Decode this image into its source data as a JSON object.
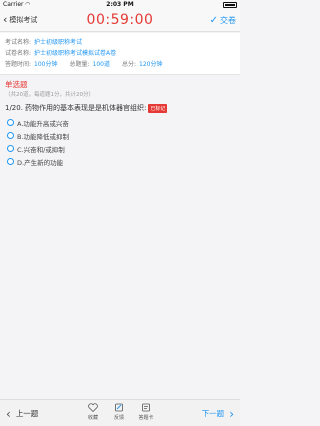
{
  "status_bar": {
    "carrier": "Carrier",
    "time": "2:03 PM"
  },
  "nav": {
    "back_label": "模拟考试",
    "timer": "00:59:00",
    "submit_label": "交卷"
  },
  "exam_info": {
    "name_label": "考试名称:",
    "name_value": "护士初级职称考试",
    "paper_label": "试卷名称:",
    "paper_value": "护士初级职称考试模拟试卷A卷",
    "duration_label": "答题时间:",
    "duration_value": "100分钟",
    "total_questions_label": "总题量:",
    "total_questions_value": "100道",
    "total_score_label": "总分:",
    "total_score_value": "120分钟"
  },
  "section": {
    "title": "单选题",
    "subtitle": "（共20道，每道题1分，共计20分）"
  },
  "question": {
    "number": "1/20.",
    "text": "药物作用的基本表现是是机体器官组织:",
    "tag": "已标记"
  },
  "options": [
    {
      "label": "A.功能升高或兴奋"
    },
    {
      "label": "B.功能降低或抑制"
    },
    {
      "label": "C.兴奋和/或抑制"
    },
    {
      "label": "D.产生新的功能"
    }
  ],
  "bottom": {
    "prev_label": "上一题",
    "next_label": "下一题",
    "fav_label": "收藏",
    "feedback_label": "反馈",
    "card_label": "答题卡"
  },
  "colors": {
    "accent": "#2196f3",
    "timer": "#e53935"
  }
}
